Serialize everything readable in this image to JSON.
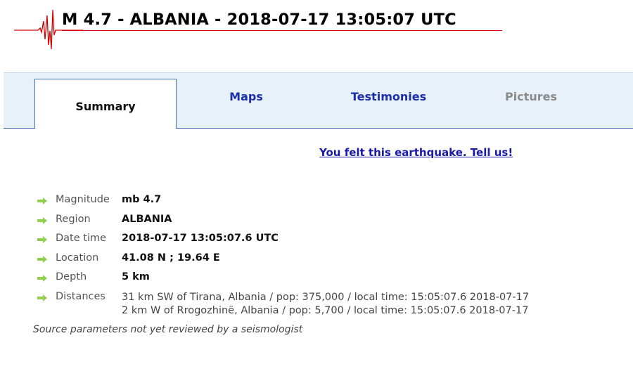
{
  "header": {
    "title": "M 4.7 - ALBANIA - 2018-07-17 13:05:07 UTC",
    "accent_color": "#d40000"
  },
  "tabs": [
    {
      "label": "Summary",
      "active": true
    },
    {
      "label": "Maps",
      "active": false
    },
    {
      "label": "Testimonies",
      "active": false
    },
    {
      "label": "Pictures",
      "active": false,
      "disabled": true
    }
  ],
  "felt_link": "You felt this earthquake. Tell us!",
  "details": {
    "magnitude": {
      "label": "Magnitude",
      "value": "mb 4.7"
    },
    "region": {
      "label": "Region",
      "value": "ALBANIA"
    },
    "datetime": {
      "label": "Date time",
      "value": "2018-07-17 13:05:07.6 UTC"
    },
    "location": {
      "label": "Location",
      "value": "41.08 N ; 19.64 E"
    },
    "depth": {
      "label": "Depth",
      "value": "5 km"
    },
    "distances": {
      "label": "Distances",
      "lines": [
        "31 km SW of Tirana, Albania / pop: 375,000 / local time: 15:05:07.6 2018-07-17",
        "2 km W of Rrogozhinë, Albania / pop: 5,700 / local time: 15:05:07.6 2018-07-17"
      ]
    }
  },
  "note": "Source parameters not yet reviewed by a seismologist",
  "icons": {
    "logo": "seismogram-logo",
    "row_bullet": "green-arrow-icon"
  },
  "colors": {
    "tab_bar_bg": "#e8f0fa",
    "tab_border": "#3f6fb8",
    "link": "#1a2fa8",
    "arrow_green": "#8fd14f",
    "disabled_tab": "#8a8a8a"
  }
}
